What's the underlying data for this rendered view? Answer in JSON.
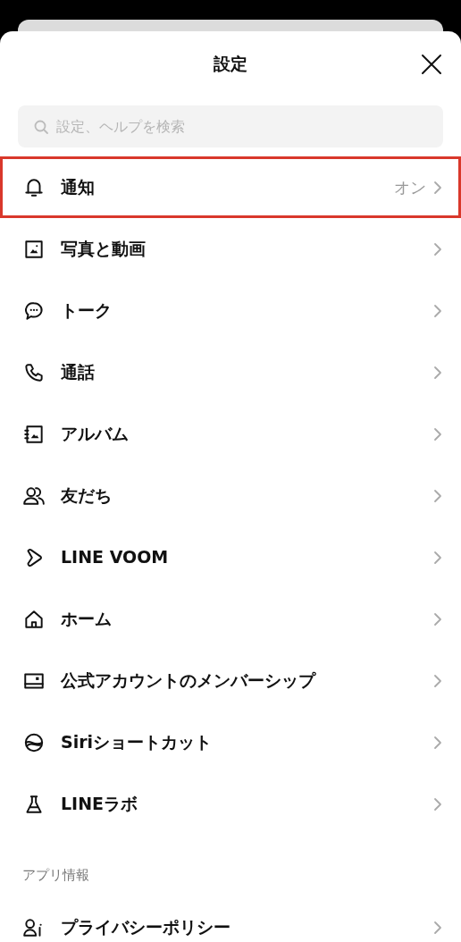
{
  "header": {
    "title": "設定"
  },
  "search": {
    "placeholder": "設定、ヘルプを検索"
  },
  "items": [
    {
      "label": "通知",
      "value": "オン",
      "highlighted": true
    },
    {
      "label": "写真と動画",
      "highlighted": false
    },
    {
      "label": "トーク",
      "highlighted": false
    },
    {
      "label": "通話",
      "highlighted": false
    },
    {
      "label": "アルバム",
      "highlighted": false
    },
    {
      "label": "友だち",
      "highlighted": false
    },
    {
      "label": "LINE VOOM",
      "highlighted": false
    },
    {
      "label": "ホーム",
      "highlighted": false
    },
    {
      "label": "公式アカウントのメンバーシップ",
      "highlighted": false
    },
    {
      "label": "Siriショートカット",
      "highlighted": false
    },
    {
      "label": "LINEラボ",
      "highlighted": false
    }
  ],
  "section": {
    "title": "アプリ情報",
    "items": [
      {
        "label": "プライバシーポリシー",
        "highlighted": false
      }
    ]
  }
}
